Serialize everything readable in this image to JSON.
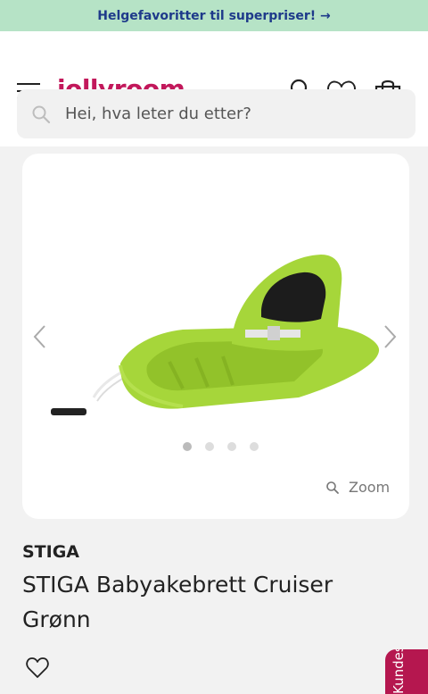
{
  "promo": {
    "text": "Helgefavoritter til superpriser! →"
  },
  "header": {
    "logo": "jollyroom.",
    "search_placeholder": "Hei, hva leter du etter?"
  },
  "gallery": {
    "zoom_label": "Zoom",
    "slide_count": 4,
    "active_slide": 1
  },
  "product": {
    "brand": "STIGA",
    "title": "STIGA Babyakebrett Cruiser Grønn"
  },
  "service_tab": {
    "label": "Kundeservice"
  },
  "colors": {
    "brand": "#c2185b",
    "promo_bg": "#b6e3c6",
    "promo_text": "#1e3a8a",
    "product_green": "#a6d63a"
  }
}
